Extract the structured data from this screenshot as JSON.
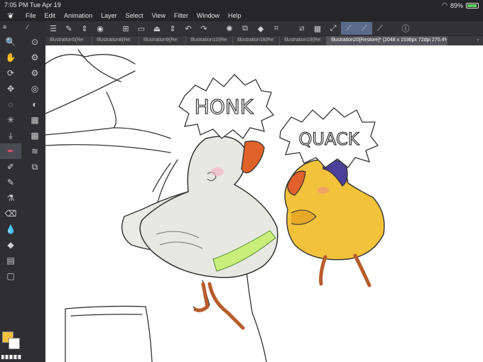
{
  "status": {
    "time": "7:05 PM",
    "date": "Tue Apr 19",
    "battery": "89%"
  },
  "menu": [
    "File",
    "Edit",
    "Animation",
    "Layer",
    "Select",
    "View",
    "Filter",
    "Window",
    "Help"
  ],
  "tabs": [
    "Illustration5(Re:",
    "Illustration8(Re:",
    "Illustration9(Re:",
    "Illustration10(Re:",
    "Illustration18(Re:",
    "Illustration19(Re:"
  ],
  "active_tab": "Illustration20[Restore]* (2048 x 1536px 72dpi 270.4%)",
  "canvas_text": {
    "honk": "HONK",
    "quack": "QUACK"
  },
  "colors": {
    "main": "#f2c23a",
    "sub": "#ffffff",
    "accent": "#5a6a8a"
  }
}
